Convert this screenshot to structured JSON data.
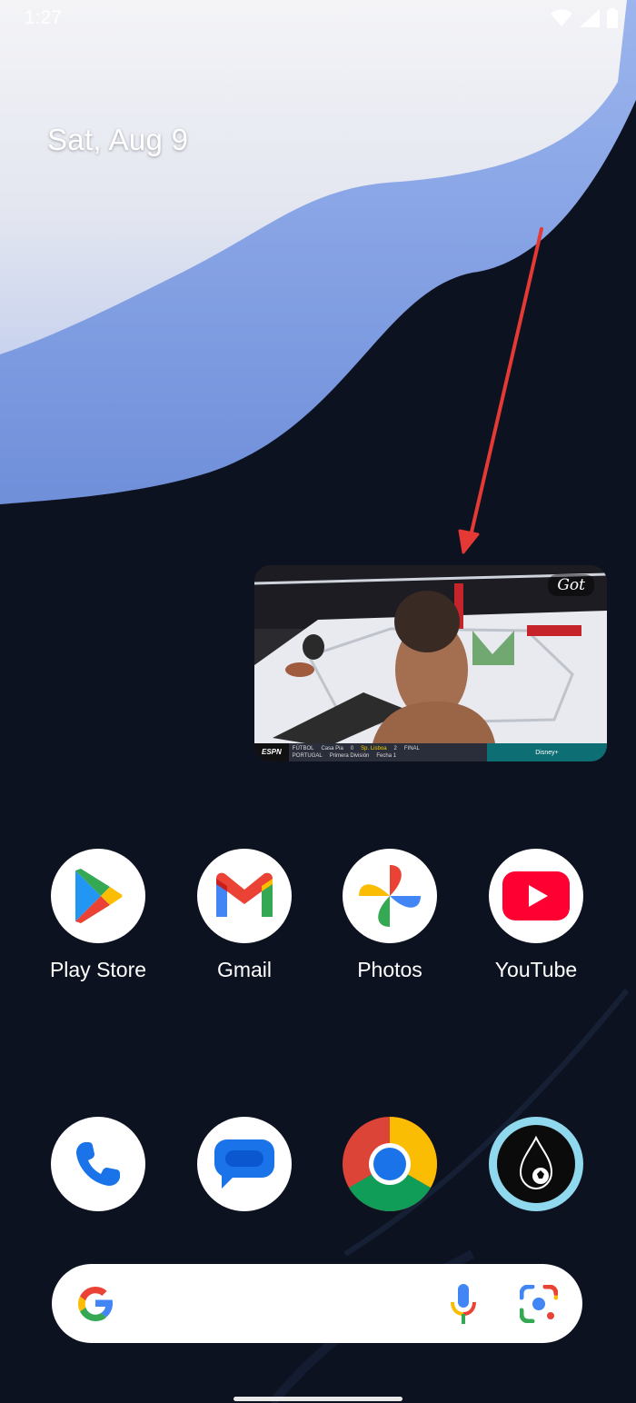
{
  "status_bar": {
    "time": "1:27",
    "icons": [
      "wifi-icon",
      "cell-signal-icon",
      "battery-icon"
    ]
  },
  "home": {
    "date": "Sat, Aug 9"
  },
  "pip_video": {
    "watermark": "Got",
    "ticker": {
      "network": "ESPN",
      "league": "FÚTBOL",
      "country": "PORTUGAL",
      "home_team": "Casa Pia",
      "home_score": "0",
      "away_team": "Sp. Lisboa",
      "away_score": "2",
      "status": "FINAL",
      "division": "Primera División",
      "round": "Fecha 1",
      "brand": "Disney+"
    }
  },
  "apps_row1": [
    {
      "label": "Play Store",
      "icon": "play-store-icon"
    },
    {
      "label": "Gmail",
      "icon": "gmail-icon"
    },
    {
      "label": "Photos",
      "icon": "photos-icon"
    },
    {
      "label": "YouTube",
      "icon": "youtube-icon"
    }
  ],
  "dock": [
    {
      "icon": "phone-icon"
    },
    {
      "icon": "messages-icon"
    },
    {
      "icon": "chrome-icon"
    },
    {
      "icon": "soccer-drop-app-icon"
    }
  ],
  "search": {
    "icons": [
      "google-g-icon",
      "microphone-icon",
      "google-lens-icon"
    ]
  },
  "colors": {
    "arrow": "#e53935",
    "background": "#0d1220",
    "wallpaper_blue": "#8aa6e6"
  }
}
